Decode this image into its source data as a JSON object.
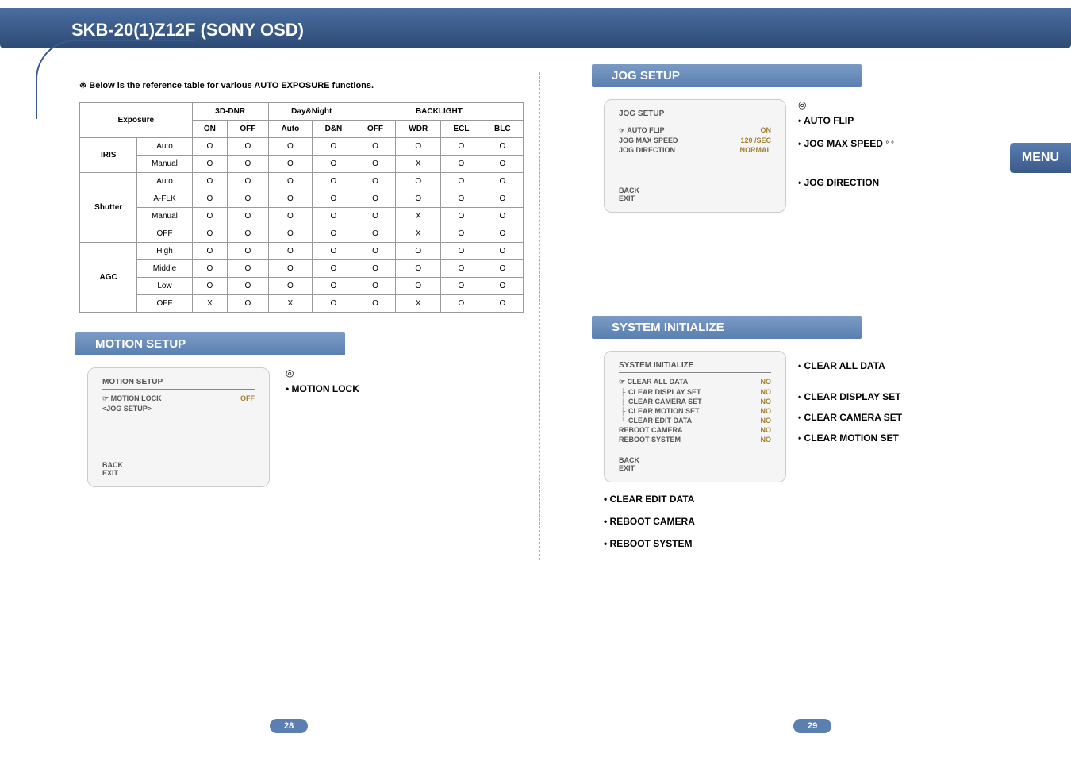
{
  "header": {
    "title": "SKB-20(1)Z12F (SONY OSD)"
  },
  "menu_tab": "MENU",
  "ref_note": "※ Below is the reference table for various AUTO EXPOSURE functions.",
  "chart_data": {
    "type": "table",
    "title": "AUTO EXPOSURE reference table",
    "col_groups": [
      {
        "label": "",
        "span": 2
      },
      {
        "label": "3D-DNR",
        "span": 2
      },
      {
        "label": "Day&Night",
        "span": 2
      },
      {
        "label": "BACKLIGHT",
        "span": 4
      }
    ],
    "columns": [
      "Exposure_Group",
      "Exposure_Mode",
      "ON",
      "OFF",
      "Auto",
      "D&N",
      "OFF",
      "WDR",
      "ECL",
      "BLC"
    ],
    "row_groups": [
      {
        "label": "IRIS",
        "modes": [
          "Auto",
          "Manual"
        ]
      },
      {
        "label": "Shutter",
        "modes": [
          "Auto",
          "A-FLK",
          "Manual",
          "OFF"
        ]
      },
      {
        "label": "AGC",
        "modes": [
          "High",
          "Middle",
          "Low",
          "OFF"
        ]
      }
    ],
    "rows": [
      [
        "IRIS",
        "Auto",
        "O",
        "O",
        "O",
        "O",
        "O",
        "O",
        "O",
        "O"
      ],
      [
        "IRIS",
        "Manual",
        "O",
        "O",
        "O",
        "O",
        "O",
        "X",
        "O",
        "O"
      ],
      [
        "Shutter",
        "Auto",
        "O",
        "O",
        "O",
        "O",
        "O",
        "O",
        "O",
        "O"
      ],
      [
        "Shutter",
        "A-FLK",
        "O",
        "O",
        "O",
        "O",
        "O",
        "O",
        "O",
        "O"
      ],
      [
        "Shutter",
        "Manual",
        "O",
        "O",
        "O",
        "O",
        "O",
        "X",
        "O",
        "O"
      ],
      [
        "Shutter",
        "OFF",
        "O",
        "O",
        "O",
        "O",
        "O",
        "X",
        "O",
        "O"
      ],
      [
        "AGC",
        "High",
        "O",
        "O",
        "O",
        "O",
        "O",
        "O",
        "O",
        "O"
      ],
      [
        "AGC",
        "Middle",
        "O",
        "O",
        "O",
        "O",
        "O",
        "O",
        "O",
        "O"
      ],
      [
        "AGC",
        "Low",
        "O",
        "O",
        "O",
        "O",
        "O",
        "O",
        "O",
        "O"
      ],
      [
        "AGC",
        "OFF",
        "X",
        "O",
        "X",
        "O",
        "O",
        "X",
        "O",
        "O"
      ]
    ]
  },
  "motion": {
    "section_title": "MOTION SETUP",
    "box_title": "MOTION SETUP",
    "items": [
      {
        "label": "☞ MOTION LOCK",
        "value": "OFF"
      },
      {
        "label": "<JOG SETUP>",
        "value": ""
      }
    ],
    "footer": [
      "BACK",
      "EXIT"
    ],
    "opts_symbol": "◎",
    "opt1": "• MOTION LOCK"
  },
  "jog": {
    "section_title": "JOG SETUP",
    "box_title": "JOG SETUP",
    "items": [
      {
        "label": "☞ AUTO FLIP",
        "value": "ON"
      },
      {
        "label": "JOG MAX SPEED",
        "value": "120 /SEC"
      },
      {
        "label": "JOG DIRECTION",
        "value": "NORMAL"
      }
    ],
    "footer": [
      "BACK",
      "EXIT"
    ],
    "opts_symbol": "◎",
    "opt1": "• AUTO FLIP",
    "opt2": "• JOG MAX SPEED",
    "opt2_suffix": "°              °",
    "opt3": "• JOG DIRECTION"
  },
  "sys": {
    "section_title": "SYSTEM INITIALIZE",
    "box_title": "SYSTEM INITIALIZE",
    "items": [
      {
        "label": "☞ CLEAR ALL DATA",
        "value": "NO"
      },
      {
        "label": "CLEAR DISPLAY SET",
        "value": "NO",
        "tree": true
      },
      {
        "label": "CLEAR CAMERA SET",
        "value": "NO",
        "tree": true
      },
      {
        "label": "CLEAR MOTION SET",
        "value": "NO",
        "tree": true
      },
      {
        "label": "CLEAR EDIT DATA",
        "value": "NO",
        "tree": true,
        "last": true
      },
      {
        "label": "REBOOT CAMERA",
        "value": "NO"
      },
      {
        "label": "REBOOT SYSTEM",
        "value": "NO"
      }
    ],
    "footer": [
      "BACK",
      "EXIT"
    ],
    "opt1": "• CLEAR ALL DATA",
    "opt2": "• CLEAR DISPLAY SET",
    "opt3": "• CLEAR CAMERA SET",
    "opt4": "• CLEAR MOTION SET",
    "extra1": "• CLEAR EDIT DATA",
    "extra2": "• REBOOT CAMERA",
    "extra3": "• REBOOT SYSTEM"
  },
  "pages": {
    "left": "28",
    "right": "29"
  }
}
